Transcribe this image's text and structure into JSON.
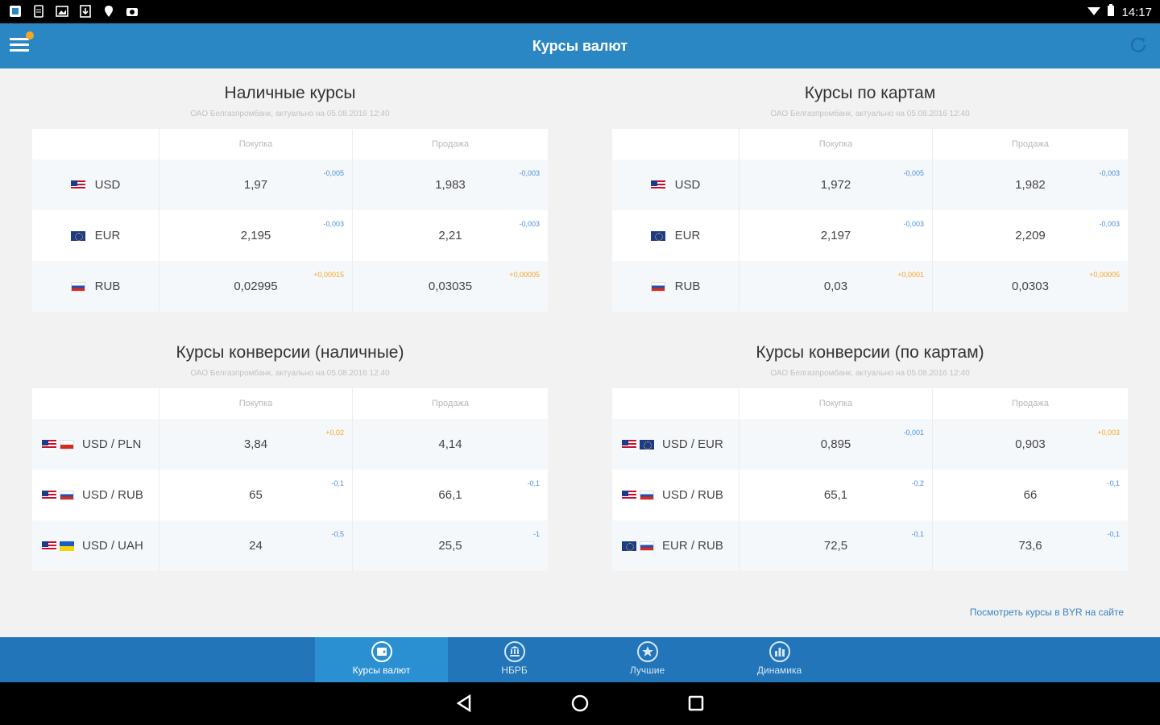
{
  "status_bar": {
    "time": "14:17"
  },
  "app_bar": {
    "title": "Курсы валют"
  },
  "sections": [
    {
      "title": "Наличные курсы",
      "subtitle": "ОАО Белгазпромбанк, актуально на 05.08.2016 12:40",
      "headers": [
        "",
        "Покупка",
        "Продажа"
      ],
      "rows": [
        {
          "flags": [
            "us"
          ],
          "currency": "USD",
          "buy": "1,97",
          "buy_delta": "-0,005",
          "buy_sign": "neg",
          "sell": "1,983",
          "sell_delta": "-0,003",
          "sell_sign": "neg"
        },
        {
          "flags": [
            "eu"
          ],
          "currency": "EUR",
          "buy": "2,195",
          "buy_delta": "-0,003",
          "buy_sign": "neg",
          "sell": "2,21",
          "sell_delta": "-0,003",
          "sell_sign": "neg"
        },
        {
          "flags": [
            "ru"
          ],
          "currency": "RUB",
          "buy": "0,02995",
          "buy_delta": "+0,00015",
          "buy_sign": "pos",
          "sell": "0,03035",
          "sell_delta": "+0,00005",
          "sell_sign": "pos"
        }
      ]
    },
    {
      "title": "Курсы по картам",
      "subtitle": "ОАО Белгазпромбанк, актуально на 05.08.2016 12:40",
      "headers": [
        "",
        "Покупка",
        "Продажа"
      ],
      "rows": [
        {
          "flags": [
            "us"
          ],
          "currency": "USD",
          "buy": "1,972",
          "buy_delta": "-0,005",
          "buy_sign": "neg",
          "sell": "1,982",
          "sell_delta": "-0,003",
          "sell_sign": "neg"
        },
        {
          "flags": [
            "eu"
          ],
          "currency": "EUR",
          "buy": "2,197",
          "buy_delta": "-0,003",
          "buy_sign": "neg",
          "sell": "2,209",
          "sell_delta": "-0,003",
          "sell_sign": "neg"
        },
        {
          "flags": [
            "ru"
          ],
          "currency": "RUB",
          "buy": "0,03",
          "buy_delta": "+0,0001",
          "buy_sign": "pos",
          "sell": "0,0303",
          "sell_delta": "+0,00005",
          "sell_sign": "pos"
        }
      ]
    },
    {
      "title": "Курсы конверсии (наличные)",
      "subtitle": "ОАО Белгазпромбанк, актуально на 05.08.2016 12:40",
      "headers": [
        "",
        "Покупка",
        "Продажа"
      ],
      "rows": [
        {
          "flags": [
            "us",
            "pl"
          ],
          "currency": "USD / PLN",
          "buy": "3,84",
          "buy_delta": "+0,02",
          "buy_sign": "pos",
          "sell": "4,14",
          "sell_delta": "",
          "sell_sign": "neg"
        },
        {
          "flags": [
            "us",
            "ru"
          ],
          "currency": "USD / RUB",
          "buy": "65",
          "buy_delta": "-0,1",
          "buy_sign": "neg",
          "sell": "66,1",
          "sell_delta": "-0,1",
          "sell_sign": "neg"
        },
        {
          "flags": [
            "us",
            "ua"
          ],
          "currency": "USD / UAH",
          "buy": "24",
          "buy_delta": "-0,5",
          "buy_sign": "neg",
          "sell": "25,5",
          "sell_delta": "-1",
          "sell_sign": "neg"
        }
      ]
    },
    {
      "title": "Курсы конверсии (по картам)",
      "subtitle": "ОАО Белгазпромбанк, актуально на 05.08.2016 12:40",
      "headers": [
        "",
        "Покупка",
        "Продажа"
      ],
      "rows": [
        {
          "flags": [
            "us",
            "eu"
          ],
          "currency": "USD / EUR",
          "buy": "0,895",
          "buy_delta": "-0,001",
          "buy_sign": "neg",
          "sell": "0,903",
          "sell_delta": "+0,003",
          "sell_sign": "pos"
        },
        {
          "flags": [
            "us",
            "ru"
          ],
          "currency": "USD / RUB",
          "buy": "65,1",
          "buy_delta": "-0,2",
          "buy_sign": "neg",
          "sell": "66",
          "sell_delta": "-0,1",
          "sell_sign": "neg"
        },
        {
          "flags": [
            "eu",
            "ru"
          ],
          "currency": "EUR / RUB",
          "buy": "72,5",
          "buy_delta": "-0,1",
          "buy_sign": "neg",
          "sell": "73,6",
          "sell_delta": "-0,1",
          "sell_sign": "neg"
        }
      ]
    }
  ],
  "site_link": "Посмотреть курсы в BYR на сайте",
  "bottom_nav": [
    {
      "label": "Курсы валют",
      "icon": "wallet-icon",
      "active": true
    },
    {
      "label": "НБРБ",
      "icon": "bank-icon",
      "active": false
    },
    {
      "label": "Лучшие",
      "icon": "star-icon",
      "active": false
    },
    {
      "label": "Динамика",
      "icon": "chart-icon",
      "active": false
    }
  ],
  "colors": {
    "primary": "#2b87c4",
    "nav": "#2175b8",
    "negative": "#4a90d9",
    "positive": "#f5a623"
  }
}
